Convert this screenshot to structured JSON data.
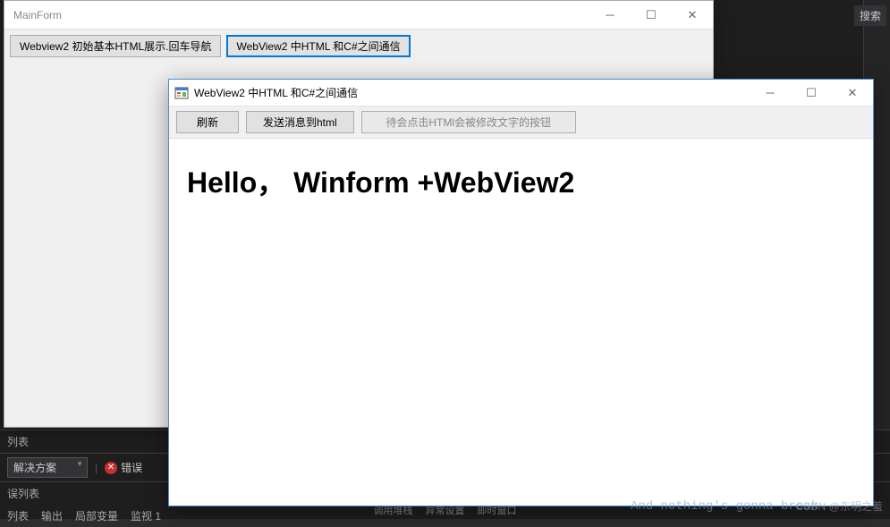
{
  "ide": {
    "right_search": "搜索",
    "bottom": {
      "list_label": "列表",
      "solution_label": "解决方案",
      "error_label": "错误",
      "error_list_label": "误列表",
      "tabs": [
        "列表",
        "输出",
        "局部变量",
        "监视 1"
      ],
      "status_items": [
        "调用堆栈",
        "异常设置",
        "即时窗口"
      ]
    }
  },
  "mainform": {
    "title": "MainForm",
    "buttons": {
      "btn1": "Webview2 初始基本HTML展示.回车导航",
      "btn2": "WebView2 中HTML 和C#之间通信"
    }
  },
  "childform": {
    "title": "WebView2 中HTML 和C#之间通信",
    "toolbar": {
      "refresh": "刷新",
      "send_msg": "发送消息到html",
      "disabled_btn": "待会点击HTMl会被修改文字的按钮"
    },
    "content_heading": "Hello， Winform +WebView2"
  },
  "watermark": {
    "line1": "And nothing's gonna break",
    "line2": "CSDN @东明之羞"
  }
}
